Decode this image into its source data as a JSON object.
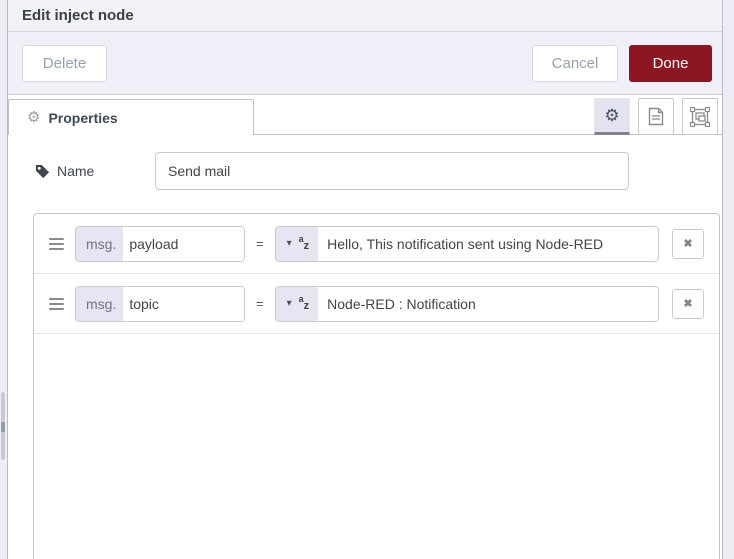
{
  "window": {
    "title": "Edit inject node"
  },
  "toolbar": {
    "delete_label": "Delete",
    "cancel_label": "Cancel",
    "done_label": "Done"
  },
  "tabs": {
    "properties_label": "Properties"
  },
  "form": {
    "name": {
      "label": "Name",
      "value": "Send mail"
    },
    "props": [
      {
        "prefix": "msg.",
        "name": "payload",
        "equals": "=",
        "value": "Hello, This notification sent using Node-RED"
      },
      {
        "prefix": "msg.",
        "name": "topic",
        "equals": "=",
        "value": "Node-RED : Notification"
      }
    ]
  },
  "icons": {
    "gear": "⚙",
    "caret_down": "▾",
    "az_a": "a",
    "az_z": "z",
    "remove": "✖"
  },
  "colors": {
    "done_button_bg": "#8c1722",
    "accent_lavender": "#e6e6f2",
    "page_background": "#efeff8"
  }
}
